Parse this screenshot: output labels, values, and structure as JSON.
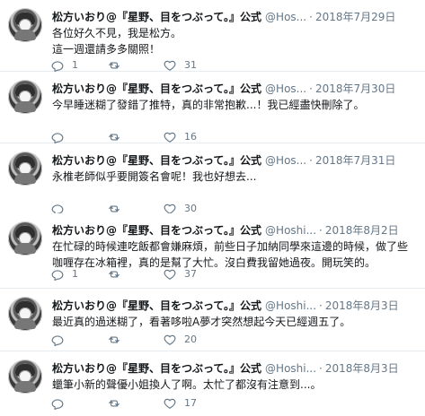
{
  "colors": {
    "text": "#14171a",
    "muted": "#657786",
    "divider": "#e6ecf0",
    "background": "#ffffff"
  },
  "icons": {
    "avatar": "avatar",
    "reply": "reply-icon",
    "retweet": "retweet-icon",
    "like": "heart-icon"
  },
  "tweets": [
    {
      "display_name": "松方いおり@『星野、目をつぶって。』公式",
      "handle": "@Hos...",
      "dot": "·",
      "date": "2018年7月29日",
      "text": "各位好久不見，我是松方。\n這一週還請多多關照！",
      "actions": {
        "reply": "1",
        "retweet": "",
        "like": "31"
      }
    },
    {
      "display_name": "松方いおり@『星野、目をつぶって。』公式",
      "handle": "@Hos...",
      "dot": "·",
      "date": "2018年7月30日",
      "text": "今早睡迷糊了發錯了推特，真的非常抱歉...！我已經盡快刪除了。",
      "actions": {
        "reply": "",
        "retweet": "",
        "like": "16"
      }
    },
    {
      "display_name": "松方いおり@『星野、目をつぶって。』公式",
      "handle": "@Hos...",
      "dot": "·",
      "date": "2018年7月31日",
      "text": "永椎老師似乎要開簽名會呢！我也好想去...",
      "actions": {
        "reply": "",
        "retweet": "",
        "like": "30"
      }
    },
    {
      "display_name": "松方いおり@『星野、目をつぶって。』公式",
      "handle": "@Hoshi...",
      "dot": "·",
      "date": "2018年8月2日",
      "text": "在忙碌的時候連吃飯都會嫌麻煩，前些日子加納同學來這邊的時候，做了些咖喱存在冰箱裡，真的是幫了大忙。沒白費我留她過夜。開玩笑的。",
      "actions": {
        "reply": "1",
        "retweet": "",
        "like": "37"
      }
    },
    {
      "display_name": "松方いおり@『星野、目をつぶって。』公式",
      "handle": "@Hoshi...",
      "dot": "·",
      "date": "2018年8月3日",
      "text": "最近真的過迷糊了，看著哆啦A夢才突然想起今天已經週五了。",
      "actions": {
        "reply": "",
        "retweet": "",
        "like": "20"
      }
    },
    {
      "display_name": "松方いおり@『星野、目をつぶって。』公式",
      "handle": "@Hoshi...",
      "dot": "·",
      "date": "2018年8月3日",
      "text": "蠟筆小新的聲優小姐換人了啊。太忙了都沒有注意到...。",
      "actions": {
        "reply": "",
        "retweet": "",
        "like": "17"
      }
    }
  ]
}
